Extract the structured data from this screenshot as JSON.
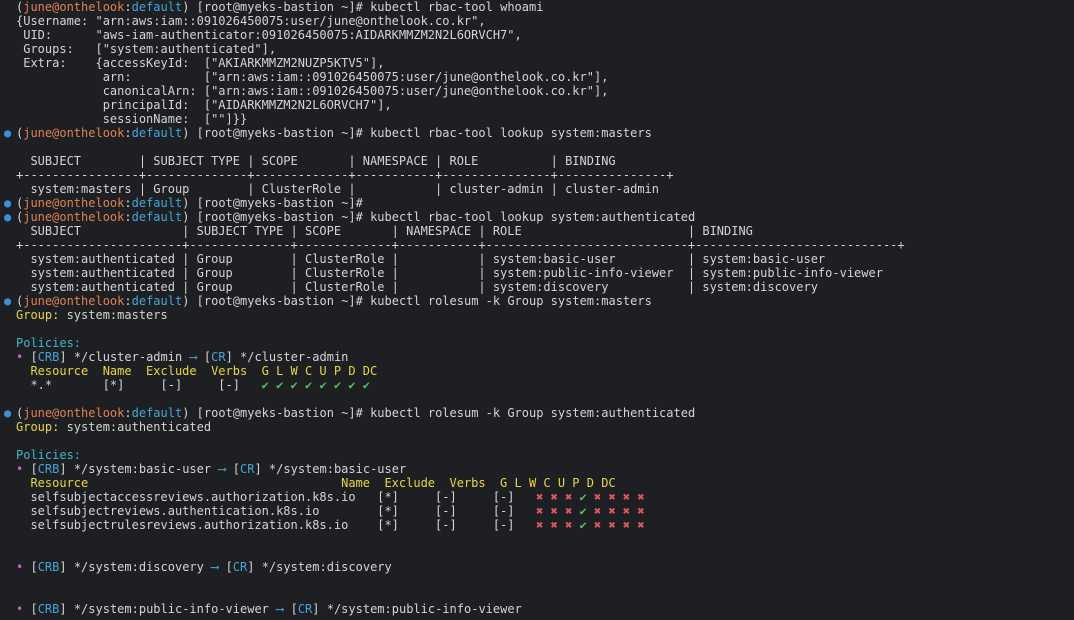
{
  "prompt": {
    "user": "june@onthelook",
    "sep": ":",
    "namespace": "default",
    "host": "[root@myeks-bastion ~]#"
  },
  "cmd1": "kubectl rbac-tool whoami",
  "whoami": [
    "{Username: \"arn:aws:iam::091026450075:user/june@onthelook.co.kr\",",
    " UID:      \"aws-iam-authenticator:091026450075:AIDARKMMZM2N2L6ORVCH7\",",
    " Groups:   [\"system:authenticated\"],",
    " Extra:    {accessKeyId:  [\"AKIARKMMZM2NUZP5KTV5\"],",
    "            arn:          [\"arn:aws:iam::091026450075:user/june@onthelook.co.kr\"],",
    "            canonicalArn: [\"arn:aws:iam::091026450075:user/june@onthelook.co.kr\"],",
    "            principalId:  [\"AIDARKMMZM2N2L6ORVCH7\"],",
    "            sessionName:  [\"\"]}}"
  ],
  "cmd2": "kubectl rbac-tool lookup system:masters",
  "lookup_masters": [
    "",
    "  SUBJECT        | SUBJECT TYPE | SCOPE       | NAMESPACE | ROLE          | BINDING",
    "+----------------+--------------+-------------+-----------+---------------+---------------+",
    "  system:masters | Group        | ClusterRole |           | cluster-admin | cluster-admin"
  ],
  "cmd3": "",
  "cmd4": "kubectl rbac-tool lookup system:authenticated",
  "lookup_auth": [
    "  SUBJECT              | SUBJECT TYPE | SCOPE       | NAMESPACE | ROLE                       | BINDING",
    "+----------------------+--------------+-------------+-----------+----------------------------+----------------------------+",
    "  system:authenticated | Group        | ClusterRole |           | system:basic-user          | system:basic-user",
    "  system:authenticated | Group        | ClusterRole |           | system:public-info-viewer  | system:public-info-viewer",
    "  system:authenticated | Group        | ClusterRole |           | system:discovery           | system:discovery"
  ],
  "cmd5": "kubectl rolesum -k Group system:masters",
  "rolesum_masters": {
    "group_label": "Group:",
    "group_value": " system:masters",
    "policies_label": "Policies:",
    "bullet": "•",
    "crb_tag": "CRB",
    "crb_name": " */cluster-admin ",
    "arrow": "⟶",
    "cr_tag": "CR",
    "cr_name": " */cluster-admin",
    "header": "  Resource  Name  Exclude  Verbs  G L W C U P D DC",
    "row_resource": "  *.*       [*]     [-]     [-]   ",
    "row_verbs": "✔ ✔ ✔ ✔ ✔ ✔ ✔ ✔"
  },
  "cmd6": "kubectl rolesum -k Group system:authenticated",
  "rolesum_auth": {
    "group_label": "Group:",
    "group_value": " system:authenticated",
    "policies_label": "Policies:",
    "bullet": "•",
    "crb_tag": "CRB",
    "crb_name": " */system:basic-user ",
    "arrow": "⟶",
    "cr_tag": "CR",
    "cr_name": " */system:basic-user",
    "header_resource": "  Resource                                   ",
    "header_cols": "Name  Exclude  Verbs  G L W C U P D DC",
    "rows": [
      {
        "resource": "  selfsubjectaccessreviews.authorization.k8s.io   [*]     [-]     [-]   ",
        "v1": "✖ ✖ ✖ ",
        "v2": "✔",
        "v3": " ✖ ✖ ✖ ✖"
      },
      {
        "resource": "  selfsubjectreviews.authentication.k8s.io        [*]     [-]     [-]   ",
        "v1": "✖ ✖ ✖ ",
        "v2": "✔",
        "v3": " ✖ ✖ ✖ ✖"
      },
      {
        "resource": "  selfsubjectrulesreviews.authorization.k8s.io    [*]     [-]     [-]   ",
        "v1": "✖ ✖ ✖ ",
        "v2": "✔",
        "v3": " ✖ ✖ ✖ ✖"
      }
    ],
    "discovery": {
      "crb_name": " */system:discovery ",
      "cr_name": " */system:discovery"
    },
    "public_info": {
      "crb_name": " */system:public-info-viewer ",
      "cr_name": " */system:public-info-viewer"
    }
  }
}
